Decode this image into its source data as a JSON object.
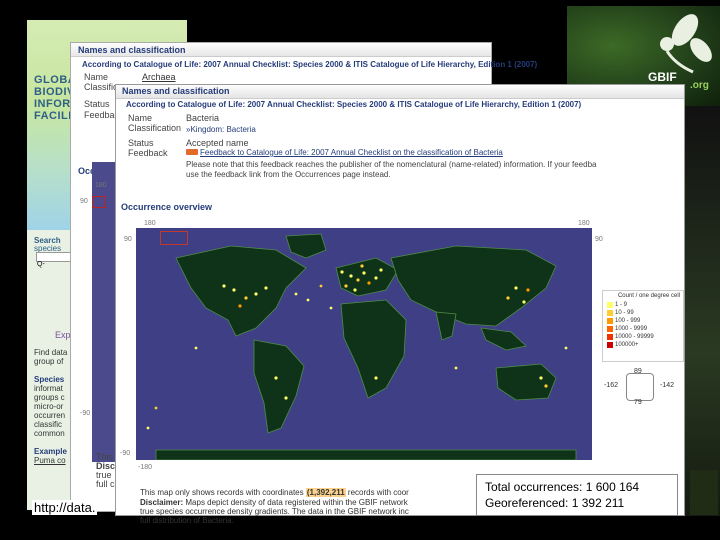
{
  "background_site": {
    "logo_lines": [
      "GLOBAL",
      "BIODIV",
      "INFORM",
      "FACILIT"
    ],
    "search_label": "Search",
    "search_sub": "species",
    "search_value": "Q-",
    "side_texts": [
      "Find data",
      "group of",
      "Species",
      "informat",
      "groups c",
      "micro-or",
      "occurren",
      "classific",
      "common",
      "Example",
      "Puma co"
    ],
    "explore_label": "Exp"
  },
  "gbif": {
    "brand": "GBIF",
    "domain": ".org"
  },
  "back_window": {
    "section_title": "Names and classification",
    "catalogue_heading": "According to Catalogue of Life: 2007 Annual Checklist: Species 2000 & ITIS Catalogue of Life Hierarchy, Edition 1 (2007)",
    "name_label": "Name",
    "name_value": "Archaea",
    "classification_label": "Classific",
    "status_label": "Status",
    "feedback_label": "Feedbac",
    "occ_label": "Occurren",
    "map_label_180": "180",
    "map_label_90": "90",
    "map_label_m90": "-90",
    "bottom_note": [
      "This",
      "Discl",
      "true",
      "full c"
    ]
  },
  "front_window": {
    "section_title": "Names and classification",
    "catalogue_heading": "According to Catalogue of Life: 2007 Annual Checklist: Species 2000 & ITIS Catalogue of Life Hierarchy, Edition 1 (2007)",
    "name_label": "Name",
    "name_value": "Bacteria",
    "classification_label": "Classification",
    "classification_value": "»Kingdom: Bacteria",
    "status_label": "Status",
    "status_value": "Accepted name",
    "feedback_label": "Feedback",
    "feedback_link": "Feedback to Catalogue of Life: 2007 Annual Checklist on the classification of Bacteria",
    "feedback_note_1": "Please note that this feedback reaches the publisher of the nomenclatural (name-related) information. If your feedba",
    "feedback_note_2": "use the feedback link from the Occurrences page instead.",
    "occurrence_title": "Occurrence overview",
    "axis": {
      "left_top": "180",
      "right_top": "180",
      "lat_top_left": "90",
      "lat_top_right": "90",
      "lat_bottom_left": "-90",
      "lon_bottom_left": "-180"
    },
    "legend_title": "Count / one degree cell",
    "legend_items": [
      {
        "label": "1 - 9",
        "color": "#ffff66"
      },
      {
        "label": "10 - 99",
        "color": "#ffcc33"
      },
      {
        "label": "100 - 999",
        "color": "#ff9900"
      },
      {
        "label": "1000 - 9999",
        "color": "#ff6600"
      },
      {
        "label": "10000 - 99999",
        "color": "#ee3300"
      },
      {
        "label": "100000+",
        "color": "#cc0000"
      }
    ],
    "mini_nav": {
      "top": "89",
      "left": "-162",
      "right": "-142",
      "bottom": "79"
    },
    "bottom_line_1_pre": "This map only shows records with coordinates",
    "bottom_line_1_count": "(1,392,211",
    "bottom_line_1_post": "records with coor",
    "disclaimer_label": "Disclaimer:",
    "disclaimer_text": "Maps depict density of data registered within the GBIF network",
    "line_3": "true species occurrence density gradients. The data in the GBIF network inc",
    "line_4": "full distribution of Bacteria."
  },
  "footer": {
    "url": "http://data.",
    "total_occurrences": "Total occurrences: 1 600 164",
    "georeferenced": "Georeferenced: 1 392 211"
  },
  "colors": {
    "map_background": "#3e3f84",
    "land": "#0f3318",
    "border": "#4f8c4a",
    "accent_title": "#253c7a"
  }
}
